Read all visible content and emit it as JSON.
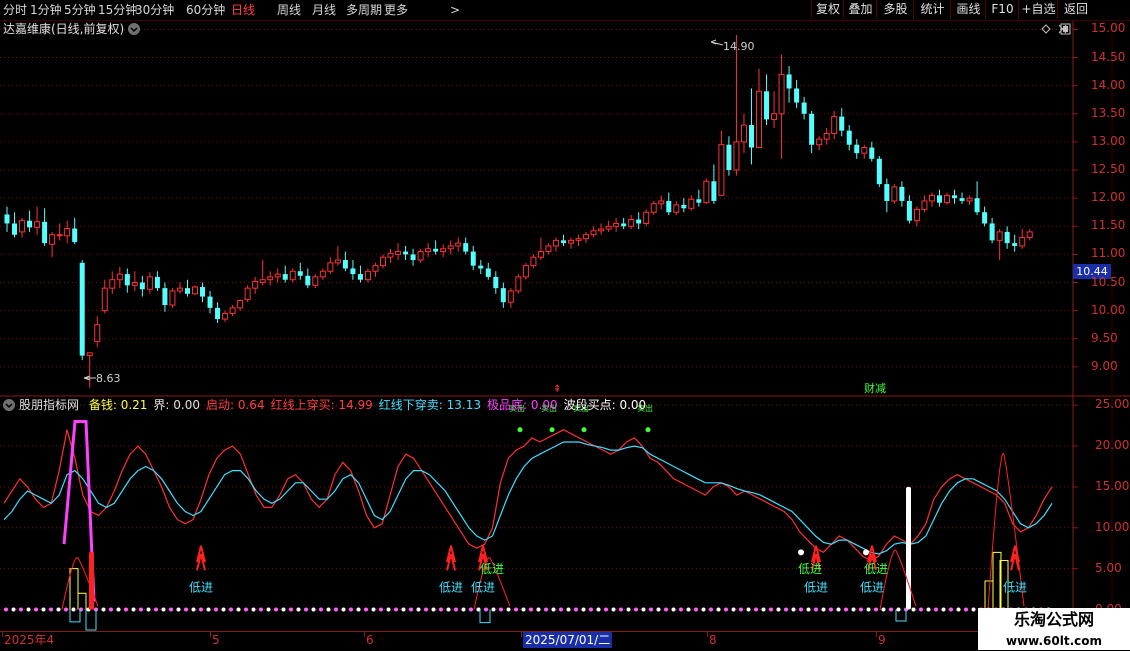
{
  "toolbar": {
    "periods": [
      "分时",
      "1分钟",
      "5分钟",
      "15分钟",
      "30分钟",
      "60分钟",
      "日线",
      "周线",
      "月线",
      "多周期",
      "更多"
    ],
    "active_period": "日线",
    "more_arrow": ">",
    "right_buttons": [
      "复权",
      "叠加",
      "多股",
      "统计",
      "画线",
      "F10",
      "+自选",
      "返回"
    ]
  },
  "main_pane": {
    "stock_title": "达嘉维康(日线,前复权)",
    "high_label": "14.90",
    "low_label": "8.63",
    "current_price": "10.44",
    "event_tag": "财减",
    "icons": [
      "diamond-icon",
      "close-icon",
      "scroll-icon",
      "collapse-icon"
    ]
  },
  "indicator_pane": {
    "name": "股朋指标网",
    "values": [
      {
        "label": "备钱:",
        "value": "0.21",
        "color": "#ffff40"
      },
      {
        "label": "界:",
        "value": "0.00",
        "color": "#e0e0e0"
      },
      {
        "label": "启动:",
        "value": "0.64",
        "color": "#ff4040"
      },
      {
        "label": "红线上穿买:",
        "value": "14.99",
        "color": "#ff4040"
      },
      {
        "label": "红线下穿卖:",
        "value": "13.13",
        "color": "#40e0ff"
      },
      {
        "label": "极品底:",
        "value": "0.00",
        "color": "#ff40ff"
      },
      {
        "label": "波段买点:",
        "value": "0.00",
        "color": "#ffffff"
      }
    ],
    "annotations": {
      "low_entry": "低进",
      "top_glyph": "卖出"
    }
  },
  "x_axis": {
    "labels": [
      "2025年4",
      "5",
      "6",
      "2025/07/01/二",
      "8",
      "9"
    ]
  },
  "watermark": {
    "line1": "乐淘公式网",
    "line2": "www.60lt.com"
  },
  "chart_data": {
    "type": "candlestick",
    "price_axis": {
      "ticks": [
        9.0,
        9.5,
        10.0,
        10.5,
        11.0,
        11.5,
        12.0,
        12.5,
        13.0,
        13.5,
        14.0,
        14.5,
        15.0
      ],
      "range": [
        8.5,
        15.15
      ]
    },
    "indicator_axis": {
      "ticks": [
        0.0,
        5.0,
        10.0,
        15.0,
        20.0,
        25.0
      ],
      "range": [
        -2.5,
        26.0
      ]
    },
    "candles": [
      [
        11.71,
        11.85,
        11.55,
        11.4
      ],
      [
        11.55,
        11.75,
        11.35,
        11.3
      ],
      [
        11.4,
        11.65,
        11.6,
        11.3
      ],
      [
        11.6,
        11.78,
        11.48,
        11.4
      ],
      [
        11.48,
        11.85,
        11.58,
        11.35
      ],
      [
        11.58,
        11.82,
        11.2,
        11.15
      ],
      [
        11.18,
        11.4,
        11.35,
        10.95
      ],
      [
        11.35,
        11.55,
        11.35,
        11.25
      ],
      [
        11.33,
        11.6,
        11.46,
        11.2
      ],
      [
        11.46,
        11.65,
        11.22,
        11.18
      ],
      [
        10.85,
        10.9,
        9.2,
        9.12
      ],
      [
        9.2,
        9.25,
        9.25,
        8.63
      ],
      [
        9.45,
        9.9,
        9.75,
        9.35
      ],
      [
        10.0,
        10.55,
        10.4,
        9.95
      ],
      [
        10.4,
        10.7,
        10.55,
        10.3
      ],
      [
        10.55,
        10.78,
        10.65,
        10.4
      ],
      [
        10.65,
        10.75,
        10.45,
        10.32
      ],
      [
        10.45,
        10.7,
        10.5,
        10.35
      ],
      [
        10.5,
        10.62,
        10.38,
        10.25
      ],
      [
        10.38,
        10.68,
        10.6,
        10.3
      ],
      [
        10.6,
        10.7,
        10.4,
        10.35
      ],
      [
        10.4,
        10.5,
        10.1,
        9.98
      ],
      [
        10.1,
        10.4,
        10.35,
        10.05
      ],
      [
        10.35,
        10.5,
        10.4,
        10.3
      ],
      [
        10.4,
        10.55,
        10.3,
        10.25
      ],
      [
        10.3,
        10.45,
        10.42,
        10.28
      ],
      [
        10.42,
        10.5,
        10.25,
        10.15
      ],
      [
        10.25,
        10.35,
        10.05,
        9.95
      ],
      [
        10.05,
        10.15,
        9.85,
        9.78
      ],
      [
        9.85,
        10.0,
        9.95,
        9.8
      ],
      [
        9.95,
        10.1,
        10.05,
        9.9
      ],
      [
        10.05,
        10.2,
        10.18,
        10.0
      ],
      [
        10.2,
        10.45,
        10.4,
        10.15
      ],
      [
        10.4,
        10.6,
        10.52,
        10.3
      ],
      [
        10.5,
        10.9,
        10.55,
        10.45
      ],
      [
        10.55,
        10.7,
        10.6,
        10.45
      ],
      [
        10.6,
        10.75,
        10.65,
        10.5
      ],
      [
        10.65,
        10.8,
        10.55,
        10.5
      ],
      [
        10.55,
        10.75,
        10.7,
        10.5
      ],
      [
        10.7,
        10.85,
        10.62,
        10.55
      ],
      [
        10.62,
        10.75,
        10.45,
        10.4
      ],
      [
        10.45,
        10.65,
        10.6,
        10.4
      ],
      [
        10.6,
        10.75,
        10.7,
        10.55
      ],
      [
        10.7,
        10.95,
        10.85,
        10.65
      ],
      [
        10.85,
        11.15,
        10.9,
        10.8
      ],
      [
        10.9,
        11.05,
        10.75,
        10.7
      ],
      [
        10.75,
        10.9,
        10.65,
        10.55
      ],
      [
        10.65,
        10.8,
        10.55,
        10.5
      ],
      [
        10.55,
        10.75,
        10.7,
        10.5
      ],
      [
        10.7,
        10.85,
        10.8,
        10.6
      ],
      [
        10.8,
        11.0,
        10.95,
        10.75
      ],
      [
        10.95,
        11.1,
        11.02,
        10.85
      ],
      [
        11.0,
        11.2,
        11.05,
        10.9
      ],
      [
        11.05,
        11.15,
        11.0,
        10.9
      ],
      [
        11.0,
        11.1,
        10.9,
        10.8
      ],
      [
        10.9,
        11.1,
        11.05,
        10.85
      ],
      [
        11.05,
        11.2,
        11.1,
        10.95
      ],
      [
        11.1,
        11.25,
        11.05,
        11.0
      ],
      [
        11.05,
        11.18,
        11.1,
        10.95
      ],
      [
        11.1,
        11.25,
        11.15,
        11.0
      ],
      [
        11.15,
        11.3,
        11.2,
        11.05
      ],
      [
        11.2,
        11.3,
        11.05,
        11.0
      ],
      [
        11.05,
        11.15,
        10.8,
        10.72
      ],
      [
        10.8,
        10.9,
        10.75,
        10.65
      ],
      [
        10.75,
        10.85,
        10.6,
        10.55
      ],
      [
        10.6,
        10.7,
        10.4,
        10.3
      ],
      [
        10.4,
        10.5,
        10.15,
        10.05
      ],
      [
        10.15,
        10.4,
        10.35,
        10.05
      ],
      [
        10.35,
        10.65,
        10.6,
        10.3
      ],
      [
        10.6,
        10.85,
        10.8,
        10.55
      ],
      [
        10.8,
        11.0,
        10.95,
        10.75
      ],
      [
        10.95,
        11.3,
        11.05,
        10.9
      ],
      [
        11.05,
        11.2,
        11.15,
        11.0
      ],
      [
        11.15,
        11.3,
        11.25,
        11.05
      ],
      [
        11.25,
        11.35,
        11.2,
        11.15
      ],
      [
        11.2,
        11.3,
        11.25,
        11.1
      ],
      [
        11.25,
        11.35,
        11.28,
        11.15
      ],
      [
        11.28,
        11.4,
        11.35,
        11.2
      ],
      [
        11.35,
        11.5,
        11.42,
        11.3
      ],
      [
        11.42,
        11.55,
        11.45,
        11.35
      ],
      [
        11.45,
        11.6,
        11.5,
        11.4
      ],
      [
        11.5,
        11.65,
        11.55,
        11.4
      ],
      [
        11.55,
        11.65,
        11.5,
        11.45
      ],
      [
        11.5,
        11.7,
        11.62,
        11.45
      ],
      [
        11.62,
        11.75,
        11.55,
        11.45
      ],
      [
        11.55,
        11.8,
        11.75,
        11.5
      ],
      [
        11.75,
        11.95,
        11.9,
        11.7
      ],
      [
        11.9,
        12.05,
        11.95,
        11.8
      ],
      [
        11.95,
        12.1,
        11.75,
        11.7
      ],
      [
        11.75,
        11.95,
        11.88,
        11.7
      ],
      [
        11.88,
        12.0,
        11.82,
        11.75
      ],
      [
        11.82,
        12.05,
        11.98,
        11.78
      ],
      [
        11.98,
        12.15,
        11.92,
        11.85
      ],
      [
        11.92,
        12.35,
        12.3,
        11.9
      ],
      [
        12.3,
        12.6,
        11.95,
        11.9
      ],
      [
        12.05,
        13.2,
        12.95,
        12.05
      ],
      [
        12.95,
        13.1,
        12.5,
        12.4
      ],
      [
        12.5,
        14.9,
        13.0,
        12.4
      ],
      [
        13.0,
        13.5,
        13.3,
        12.8
      ],
      [
        13.3,
        13.95,
        12.9,
        12.6
      ],
      [
        12.9,
        14.3,
        13.9,
        12.9
      ],
      [
        13.9,
        14.2,
        13.4,
        13.3
      ],
      [
        13.4,
        13.9,
        13.5,
        13.25
      ],
      [
        13.5,
        14.55,
        14.2,
        12.7
      ],
      [
        14.2,
        14.35,
        13.95,
        13.7
      ],
      [
        13.95,
        14.1,
        13.7,
        13.6
      ],
      [
        13.7,
        13.8,
        13.5,
        13.4
      ],
      [
        13.5,
        13.55,
        12.95,
        12.8
      ],
      [
        12.95,
        13.1,
        13.05,
        12.85
      ],
      [
        13.05,
        13.25,
        13.15,
        12.95
      ],
      [
        13.15,
        13.55,
        13.45,
        13.05
      ],
      [
        13.45,
        13.6,
        13.2,
        13.1
      ],
      [
        13.2,
        13.3,
        12.95,
        12.85
      ],
      [
        12.95,
        13.05,
        12.8,
        12.7
      ],
      [
        12.8,
        12.95,
        12.9,
        12.7
      ],
      [
        12.9,
        13.0,
        12.7,
        12.65
      ],
      [
        12.7,
        12.75,
        12.25,
        12.2
      ],
      [
        12.25,
        12.35,
        11.95,
        11.75
      ],
      [
        11.95,
        12.25,
        12.2,
        11.9
      ],
      [
        12.2,
        12.3,
        11.95,
        11.85
      ],
      [
        11.95,
        12.05,
        11.6,
        11.55
      ],
      [
        11.6,
        11.85,
        11.8,
        11.5
      ],
      [
        11.8,
        12.05,
        11.95,
        11.75
      ],
      [
        11.95,
        12.1,
        12.05,
        11.85
      ],
      [
        12.05,
        12.15,
        11.92,
        11.85
      ],
      [
        11.92,
        12.1,
        12.05,
        11.88
      ],
      [
        12.05,
        12.15,
        12.0,
        11.9
      ],
      [
        12.0,
        12.1,
        11.95,
        11.9
      ],
      [
        11.95,
        12.05,
        12.0,
        11.88
      ],
      [
        12.0,
        12.3,
        11.75,
        11.7
      ],
      [
        11.75,
        11.85,
        11.55,
        11.5
      ],
      [
        11.55,
        11.65,
        11.25,
        11.2
      ],
      [
        11.25,
        11.45,
        11.4,
        10.9
      ],
      [
        11.4,
        11.5,
        11.2,
        11.1
      ],
      [
        11.2,
        11.35,
        11.15,
        11.05
      ],
      [
        11.15,
        11.45,
        11.3,
        11.1
      ],
      [
        11.3,
        11.45,
        11.4,
        11.25
      ]
    ],
    "indicator_series": [
      {
        "color": "#ff3030",
        "values": [
          13.0,
          14.5,
          16.0,
          15.0,
          13.5,
          12.5,
          13.0,
          17.0,
          22.0,
          18.5,
          14.0,
          12.0,
          11.5,
          12.5,
          14.5,
          17.0,
          19.0,
          20.0,
          19.0,
          17.0,
          15.0,
          12.5,
          11.0,
          10.5,
          11.0,
          13.5,
          16.5,
          18.5,
          19.5,
          20.0,
          19.0,
          16.5,
          14.0,
          12.5,
          12.5,
          14.0,
          16.0,
          16.5,
          15.5,
          13.5,
          12.5,
          13.5,
          16.5,
          18.0,
          17.0,
          14.5,
          11.5,
          10.0,
          10.5,
          14.0,
          17.5,
          19.0,
          18.5,
          17.0,
          15.5,
          14.0,
          12.5,
          11.0,
          9.5,
          8.0,
          7.5,
          8.0,
          10.0,
          15.5,
          18.5,
          19.5,
          20.0,
          21.0,
          20.5,
          21.0,
          21.5,
          22.0,
          21.5,
          21.0,
          20.5,
          20.0,
          19.5,
          19.0,
          19.5,
          20.5,
          21.0,
          20.0,
          18.5,
          18.0,
          17.0,
          16.0,
          15.5,
          15.0,
          14.5,
          14.0,
          15.0,
          15.5,
          15.0,
          14.0,
          14.5,
          14.0,
          13.5,
          13.0,
          12.5,
          12.0,
          11.0,
          9.5,
          8.5,
          7.5,
          7.0,
          8.0,
          9.0,
          8.5,
          7.5,
          6.5,
          6.0,
          6.5,
          8.0,
          9.0,
          8.5,
          8.0,
          9.0,
          10.5,
          13.5,
          15.0,
          16.0,
          16.5,
          16.0,
          15.5,
          15.0,
          14.5,
          14.0,
          13.0,
          10.5,
          9.5,
          10.0,
          11.5,
          13.5,
          15.0
        ]
      },
      {
        "color": "#40e0ff",
        "values": [
          11.0,
          12.0,
          13.5,
          14.5,
          14.0,
          13.5,
          13.0,
          14.0,
          16.5,
          17.0,
          16.0,
          14.5,
          13.0,
          12.5,
          13.0,
          14.5,
          16.0,
          17.0,
          17.5,
          17.0,
          16.0,
          14.5,
          13.0,
          12.0,
          11.5,
          12.0,
          13.5,
          15.0,
          16.5,
          17.0,
          17.0,
          16.0,
          14.5,
          13.5,
          13.0,
          13.5,
          14.5,
          15.5,
          15.5,
          14.5,
          13.5,
          13.5,
          14.5,
          16.0,
          16.5,
          15.5,
          13.5,
          11.5,
          11.0,
          12.0,
          14.0,
          16.0,
          17.0,
          17.0,
          16.5,
          15.5,
          14.5,
          13.0,
          11.5,
          10.0,
          9.0,
          8.5,
          9.0,
          11.5,
          14.0,
          16.0,
          17.5,
          18.5,
          19.0,
          19.5,
          20.0,
          20.5,
          20.5,
          20.5,
          20.2,
          20.0,
          19.8,
          19.5,
          19.5,
          19.8,
          20.0,
          19.8,
          19.0,
          18.5,
          18.0,
          17.5,
          17.0,
          16.5,
          16.0,
          15.5,
          15.5,
          15.5,
          15.2,
          14.8,
          14.5,
          14.3,
          14.0,
          13.5,
          13.0,
          12.5,
          12.0,
          11.0,
          10.0,
          9.0,
          8.2,
          8.0,
          8.5,
          8.5,
          8.0,
          7.5,
          7.0,
          6.8,
          7.2,
          8.0,
          8.2,
          8.0,
          8.2,
          9.0,
          11.0,
          13.0,
          14.5,
          15.5,
          16.0,
          16.0,
          15.5,
          15.0,
          14.5,
          13.5,
          12.0,
          10.5,
          10.0,
          10.5,
          11.5,
          13.0
        ]
      }
    ]
  }
}
